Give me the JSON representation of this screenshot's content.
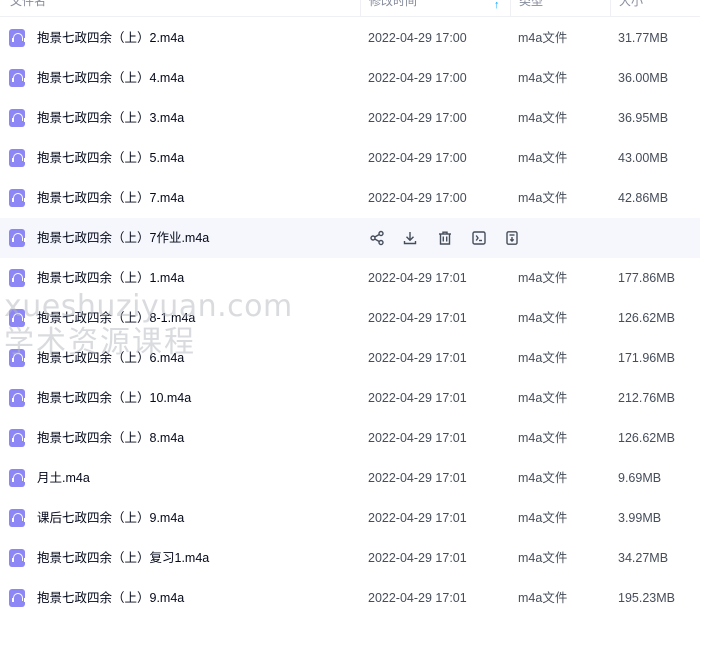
{
  "header": {
    "name": "文件名",
    "time": "修改时间",
    "type": "类型",
    "size": "大小",
    "sort_indicator": "↑"
  },
  "files": [
    {
      "name": "抱景七政四余（上）2.m4a",
      "time": "2022-04-29 17:00",
      "type": "m4a文件",
      "size": "31.77MB"
    },
    {
      "name": "抱景七政四余（上）4.m4a",
      "time": "2022-04-29 17:00",
      "type": "m4a文件",
      "size": "36.00MB"
    },
    {
      "name": "抱景七政四余（上）3.m4a",
      "time": "2022-04-29 17:00",
      "type": "m4a文件",
      "size": "36.95MB"
    },
    {
      "name": "抱景七政四余（上）5.m4a",
      "time": "2022-04-29 17:00",
      "type": "m4a文件",
      "size": "43.00MB"
    },
    {
      "name": "抱景七政四余（上）7.m4a",
      "time": "2022-04-29 17:00",
      "type": "m4a文件",
      "size": "42.86MB"
    },
    {
      "name": "抱景七政四余（上）7作业.m4a",
      "time": "",
      "type": "",
      "size": ""
    },
    {
      "name": "抱景七政四余（上）1.m4a",
      "time": "2022-04-29 17:01",
      "type": "m4a文件",
      "size": "177.86MB"
    },
    {
      "name": "抱景七政四余（上）8-1.m4a",
      "time": "2022-04-29 17:01",
      "type": "m4a文件",
      "size": "126.62MB"
    },
    {
      "name": "抱景七政四余（上）6.m4a",
      "time": "2022-04-29 17:01",
      "type": "m4a文件",
      "size": "171.96MB"
    },
    {
      "name": "抱景七政四余（上）10.m4a",
      "time": "2022-04-29 17:01",
      "type": "m4a文件",
      "size": "212.76MB"
    },
    {
      "name": "抱景七政四余（上）8.m4a",
      "time": "2022-04-29 17:01",
      "type": "m4a文件",
      "size": "126.62MB"
    },
    {
      "name": "月土.m4a",
      "time": "2022-04-29 17:01",
      "type": "m4a文件",
      "size": "9.69MB"
    },
    {
      "name": "课后七政四余（上）9.m4a",
      "time": "2022-04-29 17:01",
      "type": "m4a文件",
      "size": "3.99MB"
    },
    {
      "name": "抱景七政四余（上）复习1.m4a",
      "time": "2022-04-29 17:01",
      "type": "m4a文件",
      "size": "34.27MB"
    },
    {
      "name": "抱景七政四余（上）9.m4a",
      "time": "2022-04-29 17:01",
      "type": "m4a文件",
      "size": "195.23MB"
    }
  ],
  "hover_row_index": 5,
  "hover_actions": [
    "share-icon",
    "download-icon",
    "delete-icon",
    "rename-icon",
    "copy-icon"
  ],
  "watermark": {
    "line1": "xueshuziyuan.com",
    "line2": "学术资源课程"
  },
  "colors": {
    "icon": "#8c87f5",
    "accent": "#06a7ff",
    "hover_bg": "#f5f7fc"
  }
}
